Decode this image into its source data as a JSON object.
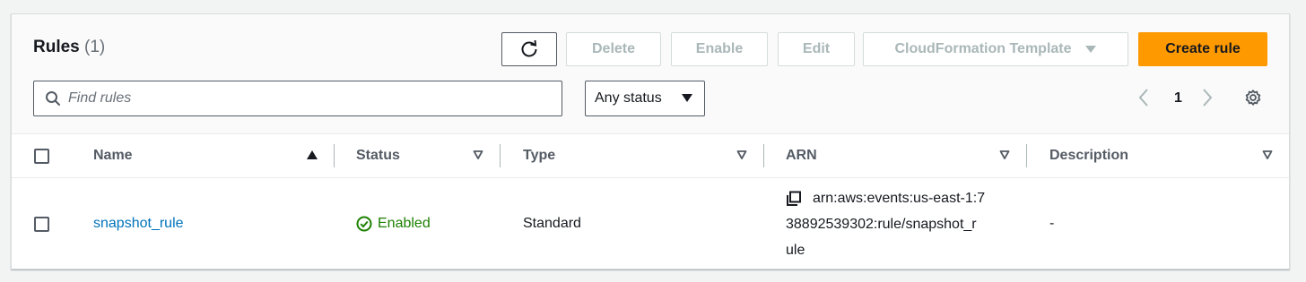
{
  "header": {
    "title": "Rules",
    "count": "(1)"
  },
  "toolbar": {
    "refresh_icon": "refresh-icon",
    "delete_label": "Delete",
    "enable_label": "Enable",
    "edit_label": "Edit",
    "cloudformation_label": "CloudFormation Template",
    "create_label": "Create rule"
  },
  "filter": {
    "search_placeholder": "Find rules",
    "search_value": "",
    "status_selected": "Any status"
  },
  "pagination": {
    "current_page": "1"
  },
  "table": {
    "columns": [
      {
        "label": "Name",
        "sort": "ascending"
      },
      {
        "label": "Status",
        "sort": "none"
      },
      {
        "label": "Type",
        "sort": "none"
      },
      {
        "label": "ARN",
        "sort": "none"
      },
      {
        "label": "Description",
        "sort": "none"
      }
    ],
    "rows": [
      {
        "name": "snapshot_rule",
        "status": "Enabled",
        "type": "Standard",
        "arn_line1": "arn:aws:events:us-east-1:7",
        "arn_line2": "38892539302:rule/snapshot_r",
        "arn_line3": "ule",
        "description": "-"
      }
    ]
  },
  "colors": {
    "primary": "#ff9900",
    "link": "#0073bb",
    "success": "#1d8102",
    "disabled_text": "#aab7b8"
  }
}
